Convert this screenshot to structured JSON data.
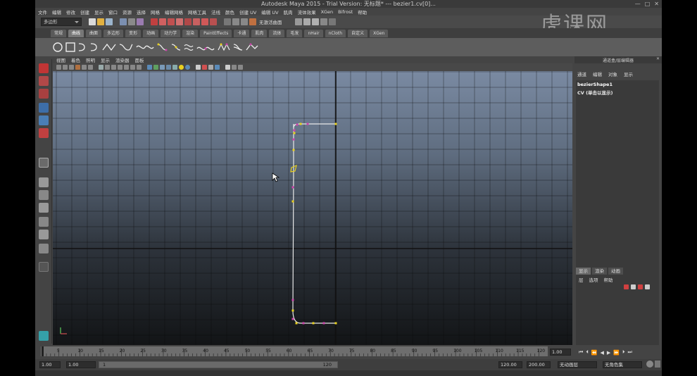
{
  "window": {
    "title": "Autodesk Maya 2015 - Trial Version: 无标题*   ---   bezier1.cv[0]..."
  },
  "watermark": "虎课网",
  "menubar": [
    "文件",
    "编辑",
    "修改",
    "创建",
    "显示",
    "窗口",
    "资源",
    "选择",
    "网格",
    "编辑网格",
    "网格工具",
    "法线",
    "颜色",
    "创建 UV",
    "编辑 UV",
    "肌肉",
    "流体效果",
    "XGen",
    "Bifrost",
    "帮助"
  ],
  "status_line": {
    "mode": "多边形",
    "live_label": "无激活曲面"
  },
  "shelf_tabs": [
    "常规",
    "曲线",
    "曲面",
    "多边形",
    "变形",
    "动画",
    "动力学",
    "渲染",
    "PaintEffects",
    "卡通",
    "肌肉",
    "流体",
    "毛发",
    "nHair",
    "nCloth",
    "自定义",
    "XGen"
  ],
  "active_shelf_tab": "曲线",
  "panel_menu": [
    "视图",
    "着色",
    "照明",
    "显示",
    "渲染器",
    "面板"
  ],
  "channel_box": {
    "header": "通道盒/层编辑器",
    "menus": [
      "通道",
      "编辑",
      "对象",
      "显示"
    ],
    "object": "bezierShape1",
    "info": "CV (单击以显示)",
    "layer_tabs": [
      "显示",
      "渲染",
      "动画"
    ],
    "active_layer_tab": "显示",
    "layer_menus": [
      "层",
      "选项",
      "帮助"
    ]
  },
  "timeline": {
    "ticks": [
      "5",
      "10",
      "15",
      "20",
      "25",
      "30",
      "35",
      "40",
      "45",
      "50",
      "55",
      "60",
      "65",
      "70",
      "75",
      "80",
      "85",
      "90",
      "95",
      "100",
      "105",
      "110",
      "115",
      "120"
    ],
    "current_frame": "1.00"
  },
  "range": {
    "start": "1.00",
    "playback_start": "1.00",
    "slider_start": "1",
    "slider_end": "120",
    "playback_end": "120.00",
    "end": "200.00",
    "anim_layer": "无动画层",
    "char_set": "无角色集"
  },
  "colors": {
    "accent": "#5b8cb8",
    "curve": "#dddddd",
    "cv": "#cc44aa",
    "select": "#e8d020"
  }
}
